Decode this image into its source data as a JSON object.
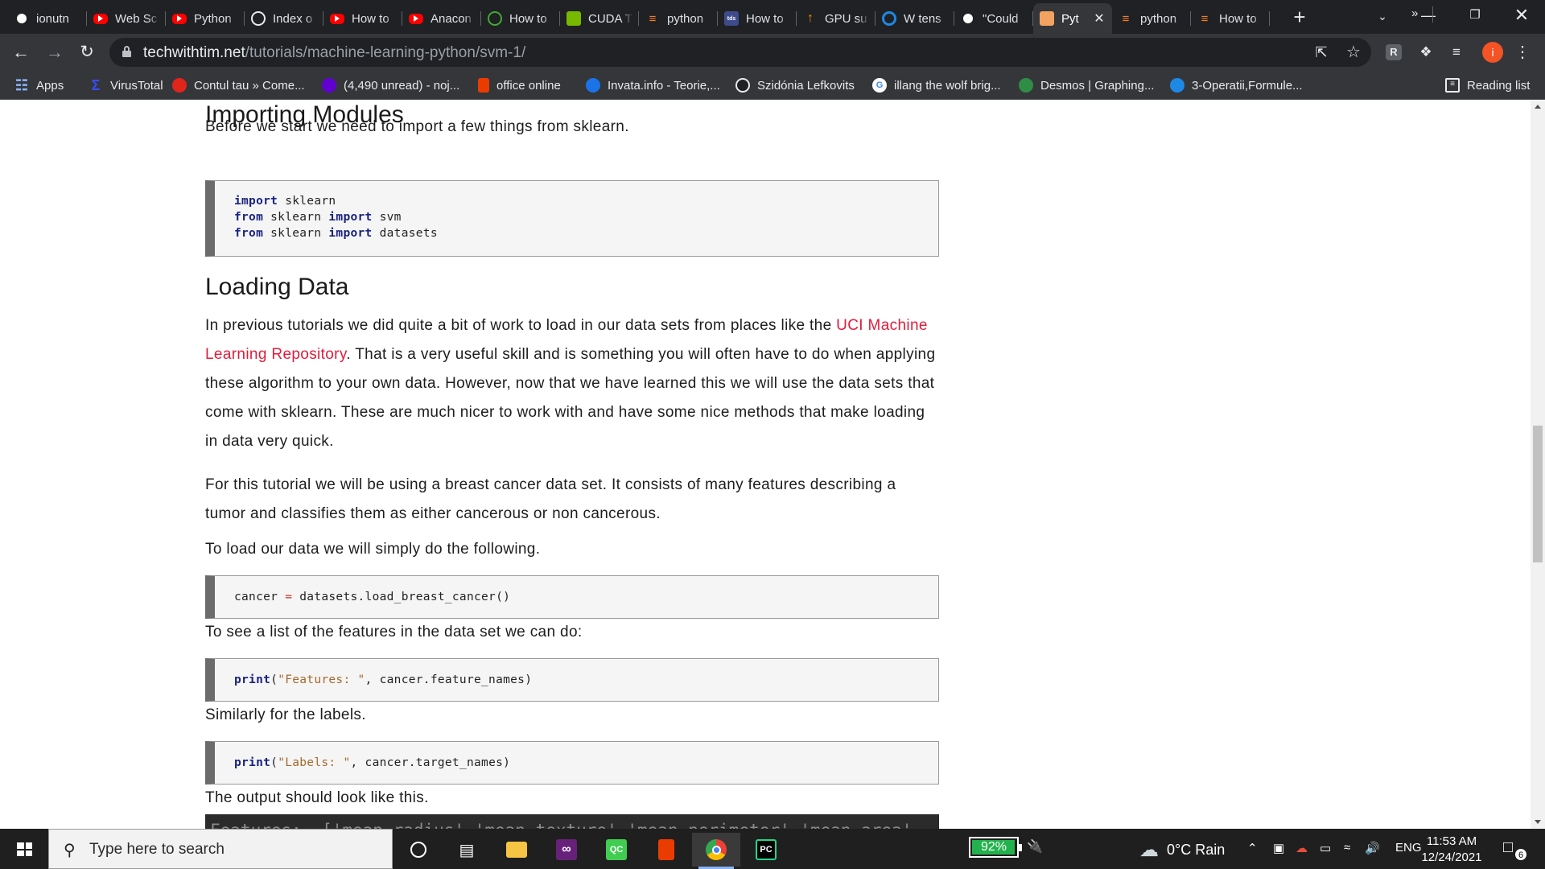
{
  "browser": {
    "tabs": [
      {
        "label": "ionutn",
        "icon": "github-icon",
        "active": false
      },
      {
        "label": "Web Sc",
        "icon": "youtube-icon",
        "active": false
      },
      {
        "label": "Python",
        "icon": "youtube-icon",
        "active": false
      },
      {
        "label": "Index o",
        "icon": "globe-icon",
        "active": false
      },
      {
        "label": "How to",
        "icon": "youtube-icon",
        "active": false
      },
      {
        "label": "Anacon",
        "icon": "youtube-icon",
        "active": false
      },
      {
        "label": "How to",
        "icon": "anaconda-icon",
        "active": false
      },
      {
        "label": "CUDA T",
        "icon": "nvidia-icon",
        "active": false
      },
      {
        "label": "python",
        "icon": "stackoverflow-icon",
        "active": false
      },
      {
        "label": "How to",
        "icon": "tds-icon",
        "active": false
      },
      {
        "label": "GPU su",
        "icon": "tensorflow-icon",
        "active": false
      },
      {
        "label": "W tens",
        "icon": "circle-icon",
        "active": false
      },
      {
        "label": "\"Could",
        "icon": "github-icon",
        "active": false
      },
      {
        "label": "Pyt",
        "icon": "techwithtim-icon",
        "active": true
      },
      {
        "label": "python",
        "icon": "stackoverflow-icon",
        "active": false
      },
      {
        "label": "How to",
        "icon": "stackoverflow-icon",
        "active": false
      }
    ],
    "new_tab": "+",
    "address": {
      "domain": "techwithtim.net",
      "path": "/tutorials/machine-learning-python/svm-1/"
    },
    "profile_initial": "i",
    "extension_letter": "R",
    "bookmarks": [
      {
        "label": "Apps",
        "icon": "apps-grid-icon",
        "color": "#4285f4"
      },
      {
        "label": "VirusTotal",
        "icon": "virustotal-icon",
        "color": "#394eff"
      },
      {
        "label": "Contul tau » Come...",
        "icon": "emag-icon",
        "color": "#e1251b"
      },
      {
        "label": "(4,490 unread) - noj...",
        "icon": "yahoo-mail-icon",
        "color": "#6001d2"
      },
      {
        "label": "office online",
        "icon": "office-icon",
        "color": "#eb3c00"
      },
      {
        "label": "Invata.info - Teorie,...",
        "icon": "invata-icon",
        "color": "#1a73e8"
      },
      {
        "label": "Szidónia Lefkovits",
        "icon": "globe-icon",
        "color": "#e8eaed"
      },
      {
        "label": "illang the wolf brig...",
        "icon": "google-icon",
        "color": "#ffffff"
      },
      {
        "label": "Desmos | Graphing...",
        "icon": "desmos-icon",
        "color": "#2f8d46"
      },
      {
        "label": "3-Operatii,Formule...",
        "icon": "site-icon",
        "color": "#1e88e5"
      }
    ],
    "bookmarks_more": "»",
    "reading_list": "Reading list"
  },
  "article": {
    "h_importing": "Importing Modules",
    "p_import_intro": "Before we start we need to import a few things from sklearn.",
    "code_imports": [
      {
        "kw": "import",
        "rest": " sklearn"
      },
      {
        "kw": "from",
        "mid": " sklearn ",
        "kw2": "import",
        "rest": " svm"
      },
      {
        "kw": "from",
        "mid": " sklearn ",
        "kw2": "import",
        "rest": " datasets"
      }
    ],
    "h_loading": "Loading Data",
    "p_loading_1a": "In previous tutorials we did quite a bit of work to load in our data sets from places like the ",
    "p_loading_link": "UCI Machine Learning Repository",
    "p_loading_1b": ". That is a very useful skill and is something you will often have to do when applying these algorithm to your own data. However, now that we have learned this we will use the data sets that come with sklearn. These are much nicer to work with and have some nice methods that make loading in data very quick.",
    "p_loading_2": "For this tutorial we will be using a breast cancer data set. It consists of many features describing a tumor and classifies them as either cancerous or non cancerous.",
    "p_loading_3": "To load our data we will simply do the following.",
    "code_load": {
      "a": "cancer ",
      "op": "=",
      "b": " datasets.load_breast_cancer()"
    },
    "p_features": "To see a list of the features in the data set we can do:",
    "code_features": {
      "kw": "print",
      "p1": "(",
      "str": "\"Features: \"",
      "rest": ", cancer.feature_names)"
    },
    "p_labels": "Similarly for the labels.",
    "code_labels": {
      "kw": "print",
      "p1": "(",
      "str": "\"Labels: \"",
      "rest": ", cancer.target_names)"
    },
    "p_output": "The output should look like this.",
    "output_partial": "Features:  ['mean radius' 'mean texture' 'mean perimeter' 'mean area'"
  },
  "taskbar": {
    "search_placeholder": "Type here to search",
    "battery_percent": "92%",
    "battery_level": 0.92,
    "weather": "0°C Rain",
    "language": "ENG",
    "time": "11:53 AM",
    "date": "12/24/2021",
    "notifications": "6",
    "apps": [
      "cortana-icon",
      "task-view-icon",
      "file-explorer-icon",
      "visual-studio-icon",
      "qt-creator-icon",
      "office-icon",
      "chrome-icon",
      "pycharm-icon"
    ]
  }
}
